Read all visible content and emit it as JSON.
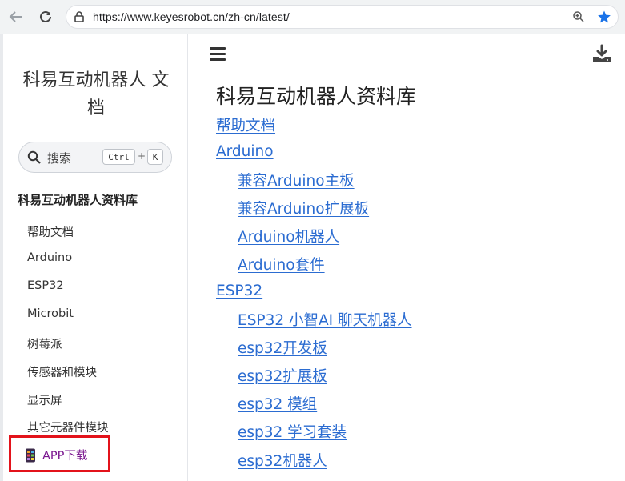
{
  "browser": {
    "url": "https://www.keyesrobot.cn/zh-cn/latest/"
  },
  "sidebar": {
    "site_title_line1": "科易互动机器人 文",
    "site_title_line2": "档",
    "search_placeholder": "搜索",
    "shortcut_key1": "Ctrl",
    "shortcut_plus": "+",
    "shortcut_key2": "K",
    "caption": "科易互动机器人资料库",
    "items": [
      "帮助文档",
      "Arduino",
      "ESP32",
      "Microbit",
      "树莓派",
      "传感器和模块",
      "显示屏",
      "其它元器件模块"
    ],
    "app_item": "APP下载"
  },
  "main": {
    "title": "科易互动机器人资料库",
    "links": [
      {
        "label": "帮助文档",
        "level": 1
      },
      {
        "label": "Arduino",
        "level": 1
      },
      {
        "label": "兼容Arduino主板",
        "level": 2
      },
      {
        "label": "兼容Arduino扩展板",
        "level": 2
      },
      {
        "label": "Arduino机器人",
        "level": 2
      },
      {
        "label": "Arduino套件",
        "level": 2
      },
      {
        "label": "ESP32",
        "level": 1
      },
      {
        "label": "ESP32 小智AI 聊天机器人",
        "level": 2
      },
      {
        "label": "esp32开发板",
        "level": 2
      },
      {
        "label": "esp32扩展板",
        "level": 2
      },
      {
        "label": "esp32 模组",
        "level": 2
      },
      {
        "label": "esp32 学习套装",
        "level": 2
      },
      {
        "label": "esp32机器人",
        "level": 2
      }
    ]
  },
  "colors": {
    "link": "#2b6cd1",
    "highlight_box": "#e3131b",
    "app_item": "#7a168f",
    "bookmark_star": "#1a73e8"
  }
}
